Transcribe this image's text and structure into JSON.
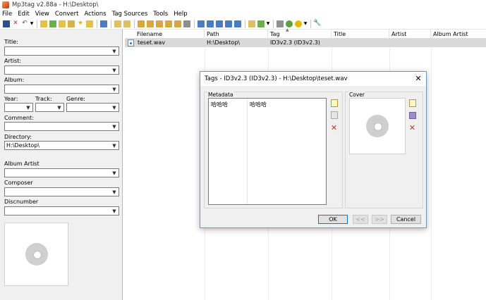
{
  "window": {
    "title": "Mp3tag v2.88a  -  H:\\Desktop\\"
  },
  "menu": [
    "File",
    "Edit",
    "View",
    "Convert",
    "Actions",
    "Tag Sources",
    "Tools",
    "Help"
  ],
  "toolbar": {
    "icons": [
      "save-icon",
      "delete-icon",
      "undo-icon",
      "change-dir-icon",
      "add-dir-icon",
      "favorite-icon",
      "select-all-icon",
      "tag-to-filename-icon",
      "filename-to-tag-icon",
      "text-file-tag-icon",
      "autonumber-icon",
      "export-icon",
      "playlist-icon",
      "actions-icon",
      "options-icon"
    ]
  },
  "left_panel": {
    "title_label": "Title:",
    "artist_label": "Artist:",
    "album_label": "Album:",
    "year_label": "Year:",
    "track_label": "Track:",
    "genre_label": "Genre:",
    "comment_label": "Comment:",
    "directory_label": "Directory:",
    "directory_value": "H:\\Desktop\\",
    "album_artist_label": "Album Artist",
    "composer_label": "Composer",
    "discnumber_label": "Discnumber"
  },
  "file_list": {
    "columns": [
      "Filename",
      "Path",
      "Tag",
      "Title",
      "Artist",
      "Album Artist"
    ],
    "rows": [
      {
        "filename": "teset.wav",
        "path": "H:\\Desktop\\",
        "tag": "ID3v2.3 (ID3v2.3)",
        "title": "",
        "artist": "",
        "album_artist": ""
      }
    ]
  },
  "dialog": {
    "title": "Tags - ID3v2.3 (ID3v2.3) - H:\\Desktop\\teset.wav",
    "metadata_label": "Metadata",
    "cover_label": "Cover",
    "metadata_rows": [
      {
        "field": "哈哈哈",
        "value": "哈哈哈"
      }
    ],
    "ok_label": "OK",
    "prev_label": "<<",
    "next_label": ">>",
    "cancel_label": "Cancel"
  },
  "colors": {
    "selected_row": "#d9d9d9",
    "dialog_border": "#6b96c8",
    "ok_border": "#0078d7"
  }
}
